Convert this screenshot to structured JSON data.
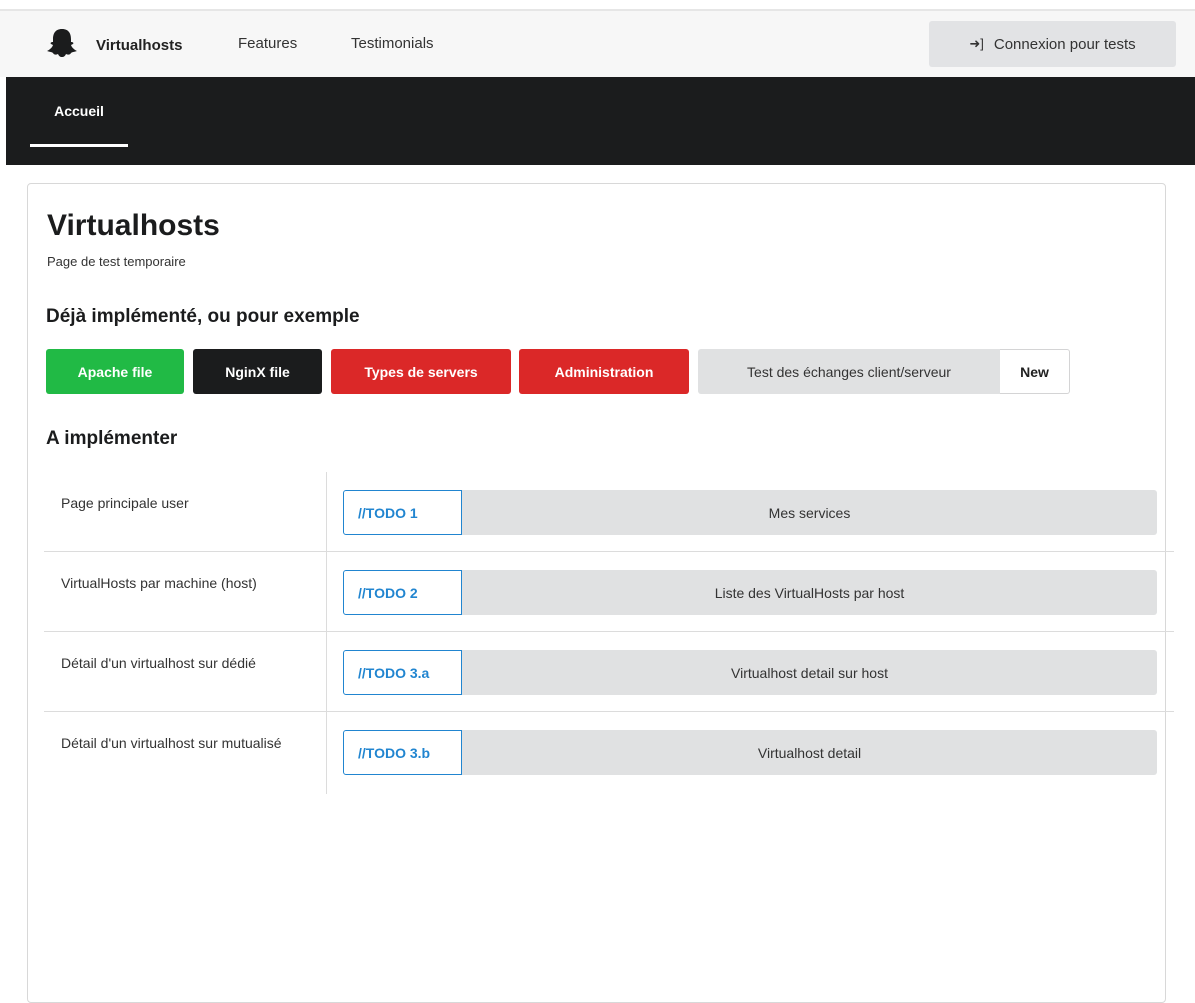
{
  "topnav": {
    "brand_label": "Virtualhosts",
    "brand_icon": "ghost-icon",
    "links": [
      "Features",
      "Testimonials"
    ],
    "login_label": "Connexion pour tests",
    "login_icon": "sign-in-icon"
  },
  "subnav": {
    "active_tab": "Accueil"
  },
  "main": {
    "title": "Virtualhosts",
    "subtitle": "Page de test temporaire",
    "section_done": "Déjà implémenté, ou pour exemple",
    "buttons": [
      {
        "label": "Apache file",
        "color": "#21ba45"
      },
      {
        "label": "NginX file",
        "color": "#1b1c1d"
      },
      {
        "label": "Types de servers",
        "color": "#db2828"
      },
      {
        "label": "Administration",
        "color": "#db2828"
      }
    ],
    "labeled_button": {
      "label": "Test des échanges client/serveur",
      "tag": "New"
    },
    "section_todo": "A implémenter",
    "todo_rows": [
      {
        "label": "Page principale user",
        "todo": "//TODO 1",
        "service": "Mes services"
      },
      {
        "label": "VirtualHosts par machine (host)",
        "todo": "//TODO 2",
        "service": "Liste des VirtualHosts par host"
      },
      {
        "label": "Détail d'un virtualhost sur dédié",
        "todo": "//TODO 3.a",
        "service": "Virtualhost detail sur host"
      },
      {
        "label": "Détail d'un virtualhost sur mutualisé",
        "todo": "//TODO 3.b",
        "service": "Virtualhost detail"
      }
    ]
  }
}
